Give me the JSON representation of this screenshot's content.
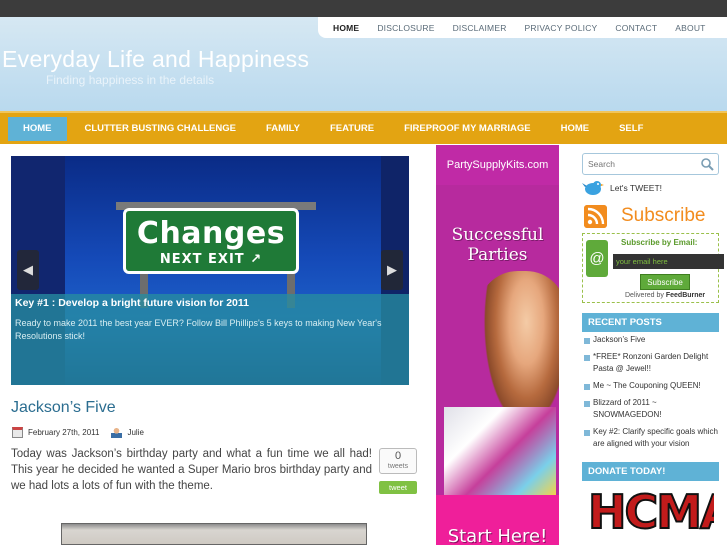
{
  "top_nav": {
    "items": [
      "HOME",
      "DISCLOSURE",
      "DISCLAIMER",
      "PRIVACY POLICY",
      "CONTACT",
      "ABOUT"
    ]
  },
  "site": {
    "title": "Everyday Life and Happiness",
    "tagline": "Finding happiness in the details"
  },
  "main_nav": {
    "items": [
      "HOME",
      "CLUTTER BUSTING CHALLENGE",
      "FAMILY",
      "FEATURE",
      "FIREPROOF MY MARRIAGE",
      "HOME",
      "SELF"
    ]
  },
  "slider": {
    "sign_line1": "Changes",
    "sign_line2": "NEXT EXIT",
    "caption_title": "Key #1 : Develop a bright future vision for 2011",
    "caption_text": "Ready to make 2011 the best year EVER? Follow Bill Phillips's 5 keys to making New Year's Resolutions stick!"
  },
  "post": {
    "title": "Jackson’s Five",
    "date": "February 27th, 2011",
    "author": "Julie",
    "body": "Today was Jackson’s birthday party and what a fun time we all had!  This year he decided he wanted a Super Mario bros birthday party and we had lots a lots of fun with the theme.",
    "tweet_count": "0",
    "tweet_label": "tweets",
    "tweet_button": "tweet"
  },
  "ad": {
    "url": "PartySupplyKits.com",
    "headline": "Successful Parties",
    "cta": "Start Here!"
  },
  "sidebar": {
    "search_placeholder": "Search",
    "lets_tweet": "Let's TWEET!",
    "subscribe": "Subscribe",
    "email_label": "Subscribe by Email:",
    "email_placeholder": "your email here",
    "email_button": "Subscribe",
    "delivered_by": "Delivered by",
    "feedburner": "FeedBurner",
    "recent_heading": "RECENT POSTS",
    "recent_posts": [
      "Jackson’s Five",
      "*FREE* Ronzoni Garden Delight Pasta @ Jewel!!",
      "Me ~ The Couponing QUEEN!",
      "Blizzard of 2011 ~ SNOWMAGEDON!",
      "Key #2: Clarify specific goals which are aligned with your vision"
    ],
    "donate_heading": "DONATE TODAY!",
    "donate_logo": "HCMA"
  },
  "colors": {
    "nav_orange": "#e3a412",
    "accent_blue": "#5fb2d6",
    "link_blue": "#2b6d90",
    "ad_pink": "#b72a9e"
  },
  "icons": [
    "search-icon",
    "twitter-bird-icon",
    "rss-icon",
    "email-at-icon",
    "calendar-icon",
    "user-icon",
    "prev-arrow-icon",
    "next-arrow-icon"
  ]
}
